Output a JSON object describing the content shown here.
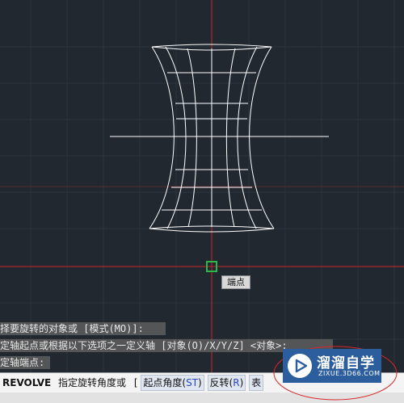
{
  "viewport": {
    "background": "#212830",
    "crosshair_color": "#c8282a",
    "wireframe_color": "#ffffff",
    "osnap_marker_color": "#2fb84a",
    "osnap_tooltip": "端点"
  },
  "command_history": [
    "择要旋转的对象或 [模式(MO)]:",
    "定轴起点或根据以下选项之一定义轴 [对象(O)/X/Y/Z] <对象>:",
    "定轴端点:"
  ],
  "command_line": {
    "close_icon": "close-icon",
    "command": "REVOLVE",
    "prompt": "指定旋转角度或",
    "open_bracket": "[",
    "options": [
      {
        "text": "起点角度(",
        "key": "ST",
        "close": ")"
      },
      {
        "text": "反转(",
        "key": "R",
        "close": ")"
      },
      {
        "text": "表",
        "key": "",
        "close": ""
      }
    ]
  },
  "watermark": {
    "icon": "play-logo-icon",
    "title": "溜溜自学",
    "url": "ZIXUE.3D66.COM",
    "highlight_color": "#d9262a"
  }
}
